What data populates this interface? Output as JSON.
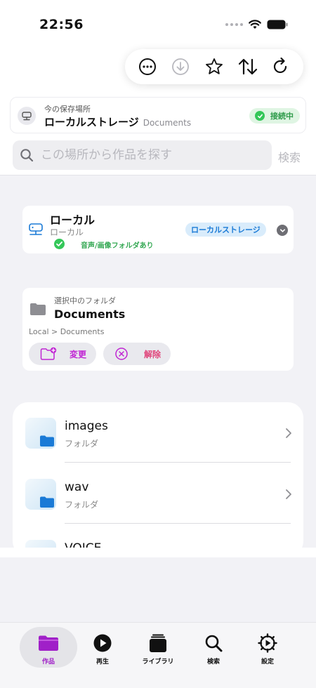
{
  "status_bar": {
    "time": "22:56"
  },
  "location": {
    "label": "今の保存場所",
    "name": "ローカルストレージ",
    "sub": "Documents",
    "badge": "接続中",
    "colors": {
      "badge_bg": "#dff5e3",
      "badge_text": "#2e9b4a"
    }
  },
  "search": {
    "placeholder": "この場所から作品を探す",
    "button": "検索"
  },
  "local_card": {
    "title": "ローカル",
    "subtitle": "ローカル",
    "status": "音声/画像フォルダあり",
    "badge": "ローカルストレージ"
  },
  "folder_card": {
    "label": "選択中のフォルダ",
    "name": "Documents",
    "path": "Local > Documents",
    "change_label": "変更",
    "release_label": "解除"
  },
  "list": {
    "items": [
      {
        "name": "images",
        "sub": "フォルダ"
      },
      {
        "name": "wav",
        "sub": "フォルダ"
      },
      {
        "name": "VOICE",
        "sub": ""
      }
    ]
  },
  "tabs": [
    {
      "label": "作品",
      "icon": "folder-icon",
      "active": true
    },
    {
      "label": "再生",
      "icon": "play-icon",
      "active": false
    },
    {
      "label": "ライブラリ",
      "icon": "library-icon",
      "active": false
    },
    {
      "label": "検索",
      "icon": "search-icon",
      "active": false
    },
    {
      "label": "設定",
      "icon": "gear-icon",
      "active": false
    }
  ],
  "colors": {
    "accent": "#a020c8",
    "folder_blue": "#1a7ad6",
    "ok_green": "#34c759"
  }
}
